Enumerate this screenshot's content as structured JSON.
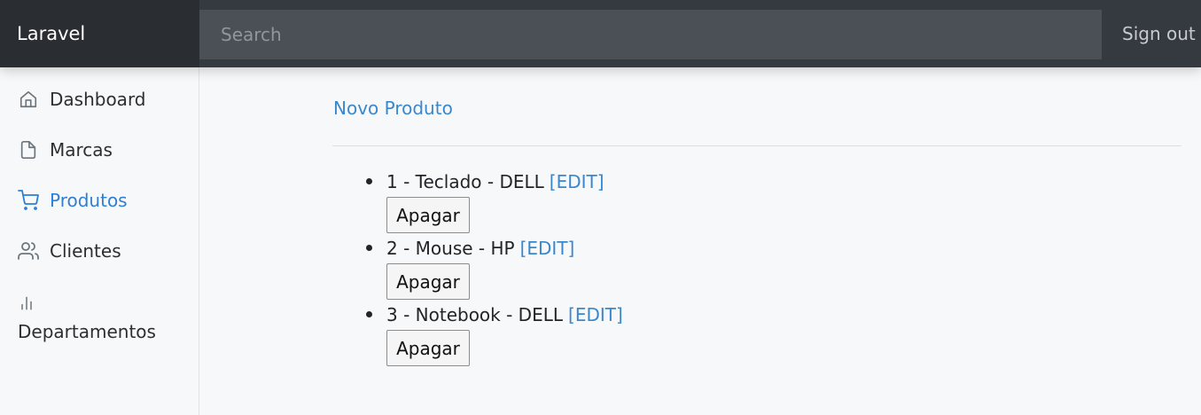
{
  "header": {
    "brand": "Laravel",
    "search_placeholder": "Search",
    "signout_label": "Sign out"
  },
  "sidebar": {
    "items": [
      {
        "label": "Dashboard",
        "icon": "home-icon",
        "active": false
      },
      {
        "label": "Marcas",
        "icon": "file-icon",
        "active": false
      },
      {
        "label": "Produtos",
        "icon": "cart-icon",
        "active": true
      },
      {
        "label": "Clientes",
        "icon": "users-icon",
        "active": false
      },
      {
        "label": "Departamentos",
        "icon": "bar-chart-icon",
        "active": false
      }
    ]
  },
  "main": {
    "new_product_link": "Novo Produto",
    "products": [
      {
        "text": "1 - Teclado - DELL",
        "edit_label": "[EDIT]",
        "delete_label": "Apagar"
      },
      {
        "text": "2 - Mouse - HP",
        "edit_label": "[EDIT]",
        "delete_label": "Apagar"
      },
      {
        "text": "3 - Notebook - DELL",
        "edit_label": "[EDIT]",
        "delete_label": "Apagar"
      }
    ]
  },
  "colors": {
    "navbar": "#343a40",
    "brand_bg": "#2a2e33",
    "accent": "#3a87cc",
    "active_nav": "#2e7fd4"
  }
}
